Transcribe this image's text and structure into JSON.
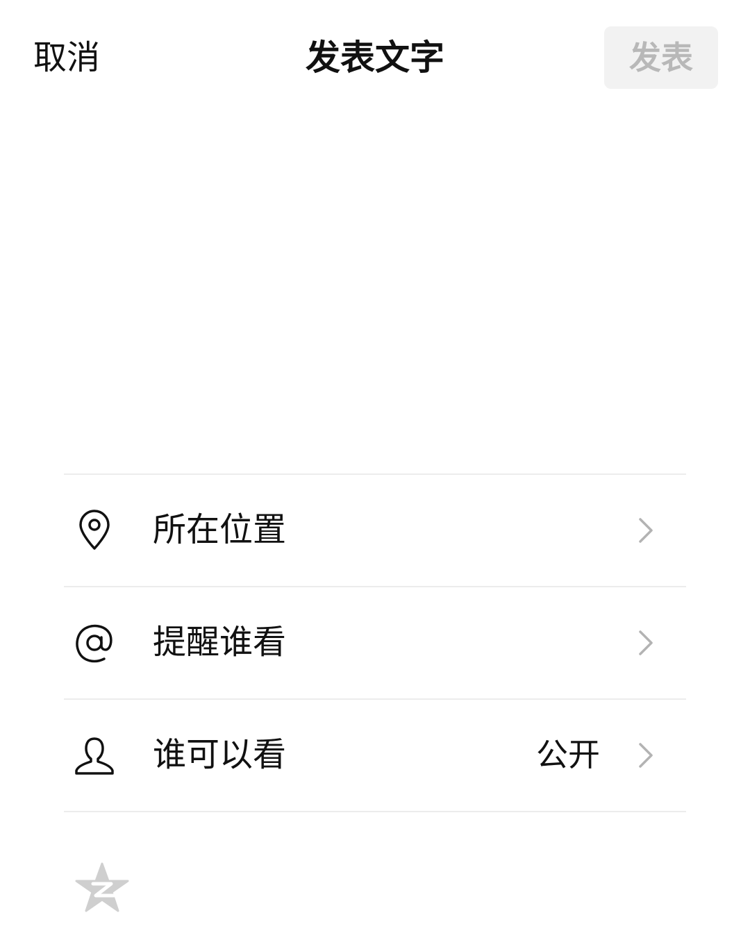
{
  "header": {
    "cancel_label": "取消",
    "title": "发表文字",
    "publish_label": "发表"
  },
  "menu": {
    "items": [
      {
        "label": "所在位置",
        "icon": "location-pin-icon",
        "value": ""
      },
      {
        "label": "提醒谁看",
        "icon": "at-sign-icon",
        "value": ""
      },
      {
        "label": "谁可以看",
        "icon": "person-icon",
        "value": "公开"
      }
    ]
  },
  "share": {
    "qzone_icon": "qzone-star-icon"
  },
  "colors": {
    "text": "#111111",
    "publish_disabled_bg": "#f2f2f2",
    "publish_disabled_text": "#b8b8b8",
    "divider": "#ececec",
    "chevron": "#b3b3b3",
    "qzone_icon": "#cfcfcf"
  }
}
